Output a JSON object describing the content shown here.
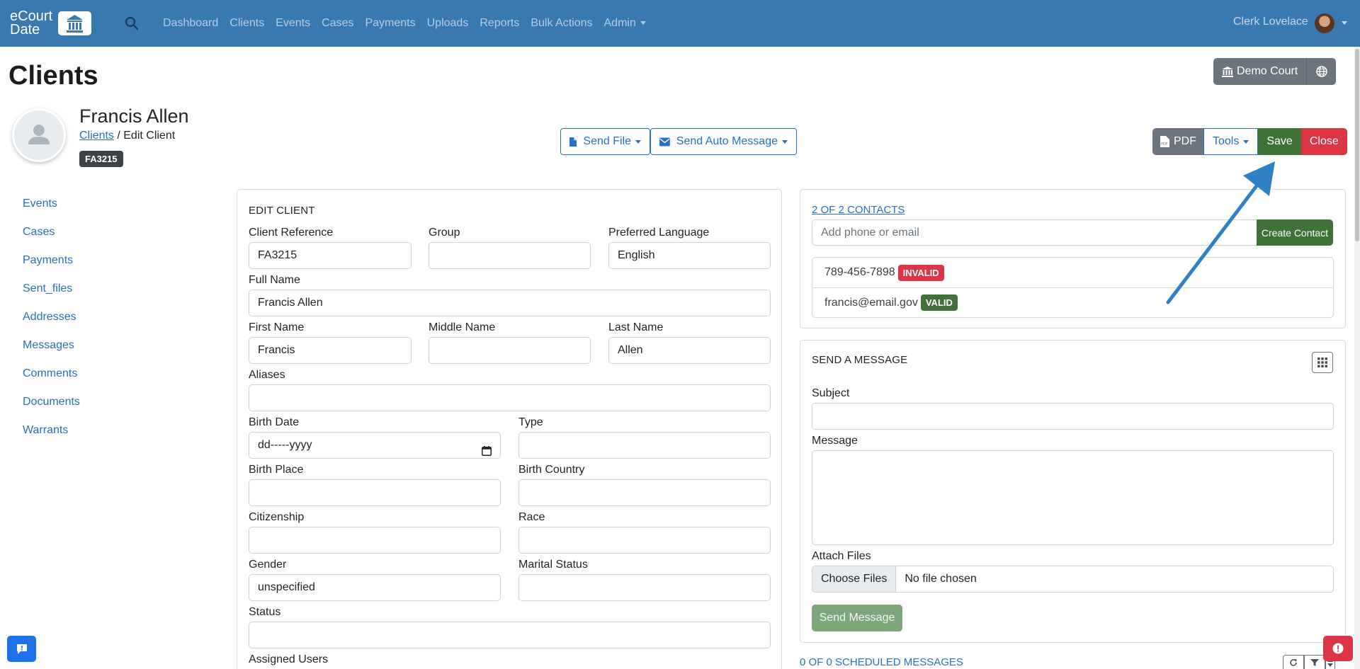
{
  "navbar": {
    "logo_line1": "eCourt",
    "logo_line2": "Date",
    "links": [
      "Dashboard",
      "Clients",
      "Events",
      "Cases",
      "Payments",
      "Uploads",
      "Reports",
      "Bulk Actions",
      "Admin"
    ],
    "user_name": "Clerk Lovelace"
  },
  "page": {
    "title": "Clients",
    "court_button": "Demo Court"
  },
  "client": {
    "name": "Francis Allen",
    "breadcrumb_link": "Clients",
    "breadcrumb_rest": " / Edit Client",
    "reference_badge": "FA3215"
  },
  "toolbar": {
    "send_file": "Send File",
    "send_auto_message": "Send Auto Message",
    "pdf": "PDF",
    "tools": "Tools",
    "save": "Save",
    "close": "Close"
  },
  "sidebar": {
    "items": [
      "Events",
      "Cases",
      "Payments",
      "Sent_files",
      "Addresses",
      "Messages",
      "Comments",
      "Documents",
      "Warrants"
    ]
  },
  "edit_client": {
    "title": "EDIT CLIENT",
    "client_reference": {
      "label": "Client Reference",
      "value": "FA3215"
    },
    "group": {
      "label": "Group",
      "value": ""
    },
    "preferred_language": {
      "label": "Preferred Language",
      "value": "English"
    },
    "full_name": {
      "label": "Full Name",
      "value": "Francis Allen"
    },
    "first_name": {
      "label": "First Name",
      "value": "Francis"
    },
    "middle_name": {
      "label": "Middle Name",
      "value": ""
    },
    "last_name": {
      "label": "Last Name",
      "value": "Allen"
    },
    "aliases": {
      "label": "Aliases",
      "value": ""
    },
    "birth_date": {
      "label": "Birth Date",
      "value": "dd-----yyyy"
    },
    "type": {
      "label": "Type",
      "value": ""
    },
    "birth_place": {
      "label": "Birth Place",
      "value": ""
    },
    "birth_country": {
      "label": "Birth Country",
      "value": ""
    },
    "citizenship": {
      "label": "Citizenship",
      "value": ""
    },
    "race": {
      "label": "Race",
      "value": ""
    },
    "gender": {
      "label": "Gender",
      "value": "unspecified"
    },
    "marital_status": {
      "label": "Marital Status",
      "value": ""
    },
    "status": {
      "label": "Status",
      "value": ""
    },
    "assigned_users": {
      "label": "Assigned Users"
    }
  },
  "contacts": {
    "header": "2 OF 2 CONTACTS",
    "input_placeholder": "Add phone or email",
    "create_button": "Create Contact",
    "items": [
      {
        "value": "789-456-7898",
        "status": "INVALID"
      },
      {
        "value": "francis@email.gov",
        "status": "VALID"
      }
    ]
  },
  "send_message": {
    "title": "SEND A MESSAGE",
    "subject_label": "Subject",
    "message_label": "Message",
    "attach_label": "Attach Files",
    "choose_files": "Choose Files",
    "no_file": "No file chosen",
    "send_button": "Send Message"
  },
  "scheduled": {
    "header": "0 OF 0 SCHEDULED MESSAGES"
  },
  "colors": {
    "navbar": "#3a78b0",
    "primary": "#2a6fc2",
    "success": "#3f7138",
    "danger": "#dc3545",
    "secondary": "#6c757d",
    "annotation_arrow": "#2f80c4"
  }
}
